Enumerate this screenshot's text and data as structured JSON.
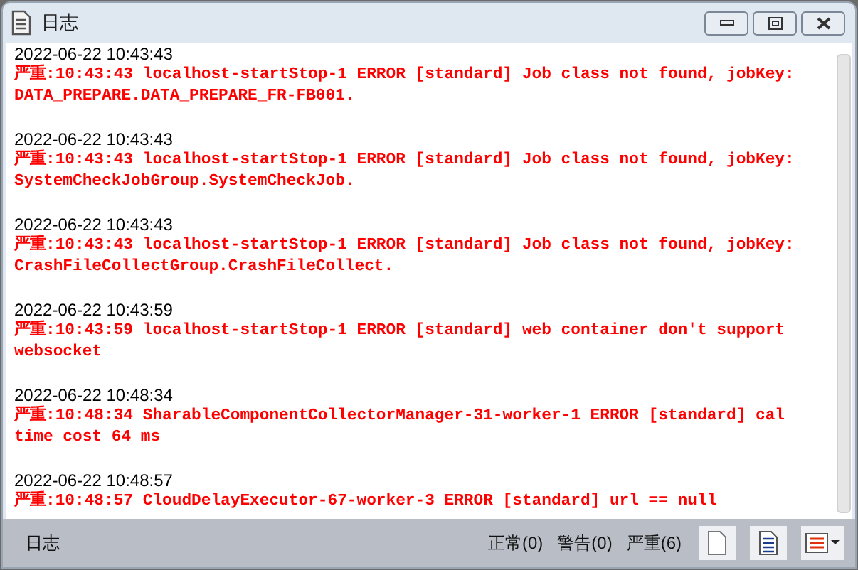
{
  "window": {
    "title": "日志"
  },
  "entries": [
    {
      "time": "2022-06-22 10:43:43",
      "message": "严重:10:43:43 localhost-startStop-1 ERROR [standard] Job class not found, jobKey: DATA_PREPARE.DATA_PREPARE_FR-FB001."
    },
    {
      "time": "2022-06-22 10:43:43",
      "message": "严重:10:43:43 localhost-startStop-1 ERROR [standard] Job class not found, jobKey: SystemCheckJobGroup.SystemCheckJob."
    },
    {
      "time": "2022-06-22 10:43:43",
      "message": "严重:10:43:43 localhost-startStop-1 ERROR [standard] Job class not found, jobKey: CrashFileCollectGroup.CrashFileCollect."
    },
    {
      "time": "2022-06-22 10:43:59",
      "message": "严重:10:43:59 localhost-startStop-1 ERROR [standard] web container don't support websocket"
    },
    {
      "time": "2022-06-22 10:48:34",
      "message": "严重:10:48:34 SharableComponentCollectorManager-31-worker-1 ERROR [standard] cal time cost 64 ms"
    },
    {
      "time": "2022-06-22 10:48:57",
      "message": "严重:10:48:57 CloudDelayExecutor-67-worker-3 ERROR [standard] url == null"
    }
  ],
  "status_bar": {
    "label": "日志",
    "counts": [
      "正常(0)",
      "警告(0)",
      "严重(6)"
    ]
  }
}
